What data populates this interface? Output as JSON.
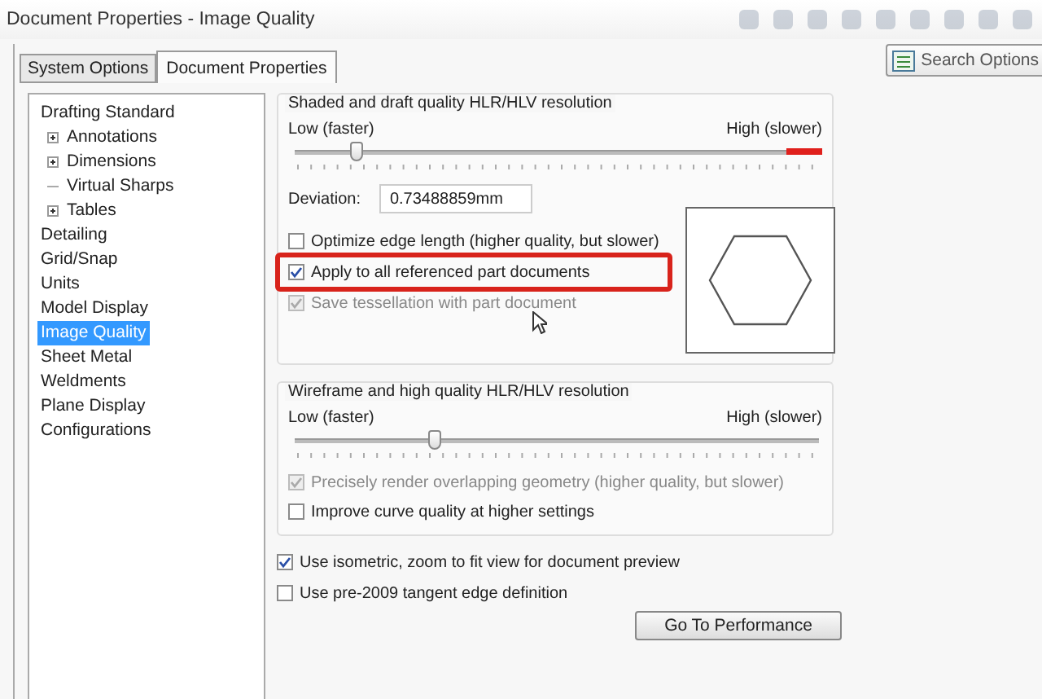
{
  "window": {
    "title": "Document Properties - Image Quality"
  },
  "tabs": [
    {
      "label": "System Options",
      "selected": false
    },
    {
      "label": "Document Properties",
      "selected": true
    }
  ],
  "search_button": {
    "label": "Search Options"
  },
  "tree": [
    {
      "label": "Drafting Standard",
      "selected": false,
      "children": [
        {
          "label": "Annotations",
          "expanded": false
        },
        {
          "label": "Dimensions",
          "expanded": false
        },
        {
          "label": "Virtual Sharps"
        },
        {
          "label": "Tables",
          "expanded": false
        }
      ]
    },
    {
      "label": "Detailing",
      "selected": false
    },
    {
      "label": "Grid/Snap",
      "selected": false
    },
    {
      "label": "Units",
      "selected": false
    },
    {
      "label": "Model Display",
      "selected": false
    },
    {
      "label": "Image Quality",
      "selected": true
    },
    {
      "label": "Sheet Metal",
      "selected": false
    },
    {
      "label": "Weldments",
      "selected": false
    },
    {
      "label": "Plane Display",
      "selected": false
    },
    {
      "label": "Configurations",
      "selected": false
    }
  ],
  "shaded_group": {
    "title": "Shaded and draft quality HLR/HLV resolution",
    "low_label": "Low (faster)",
    "high_label": "High (slower)",
    "level": 0.12,
    "deviation_label": "Deviation:",
    "deviation_value": "0.73488859mm",
    "options": [
      {
        "label": "Optimize edge length (higher quality, but slower)",
        "checked": false,
        "disabled": false,
        "highlighted": false
      },
      {
        "label": "Apply to all referenced part documents",
        "checked": true,
        "disabled": false,
        "highlighted": true
      },
      {
        "label": "Save tessellation with part document",
        "checked": true,
        "disabled": true,
        "highlighted": false
      }
    ]
  },
  "wireframe_group": {
    "title": "Wireframe and high quality HLR/HLV resolution",
    "low_label": "Low (faster)",
    "high_label": "High (slower)",
    "level": 0.27,
    "options": [
      {
        "label": "Precisely render overlapping geometry (higher quality, but slower)",
        "checked": true,
        "disabled": true
      },
      {
        "label": "Improve curve quality at higher settings",
        "checked": false,
        "disabled": false
      }
    ]
  },
  "options": [
    {
      "label": "Use isometric, zoom to fit view for document preview",
      "checked": true,
      "disabled": false
    },
    {
      "label": "Use pre-2009 tangent edge definition",
      "checked": false,
      "disabled": false
    }
  ],
  "performance_button": {
    "label": "Go To Performance"
  }
}
